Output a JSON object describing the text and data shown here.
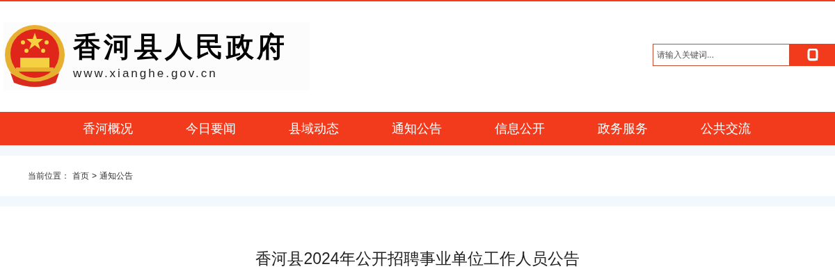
{
  "site": {
    "title": "香河县人民政府",
    "url": "www.xianghe.gov.cn"
  },
  "search": {
    "placeholder": "请输入关键词..."
  },
  "nav": [
    "香河概况",
    "今日要闻",
    "县域动态",
    "通知公告",
    "信息公开",
    "政务服务",
    "公共交流"
  ],
  "breadcrumb": {
    "label": "当前位置：",
    "items": [
      "首页",
      "通知公告"
    ],
    "separator": ">"
  },
  "article": {
    "title": "香河县2024年公开招聘事业单位工作人员公告"
  }
}
